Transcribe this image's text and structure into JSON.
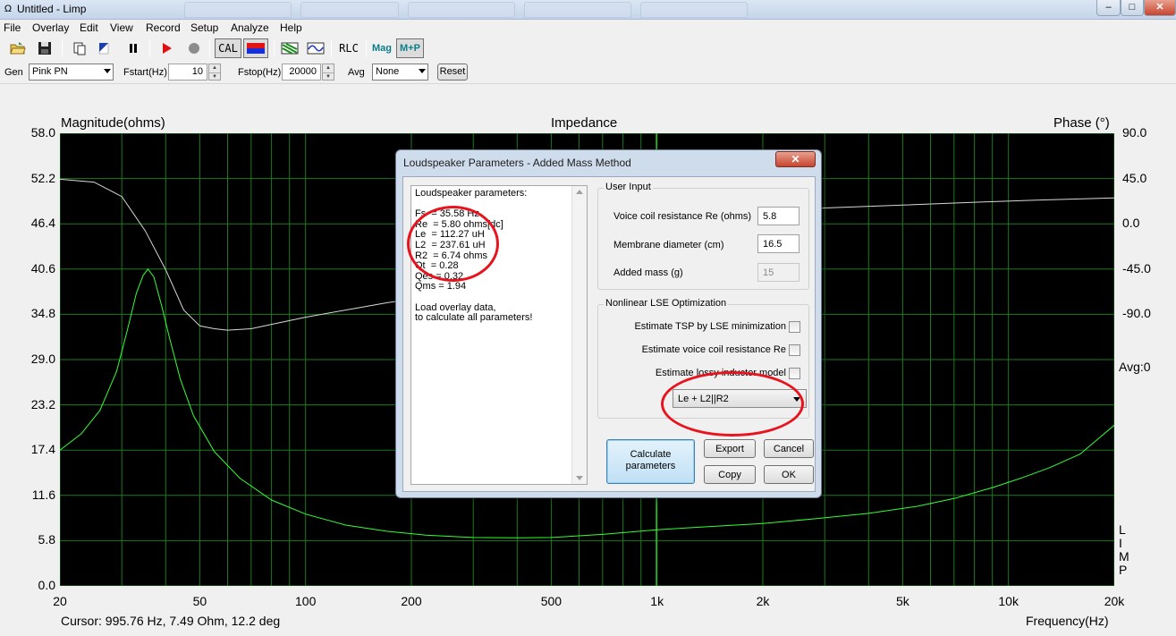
{
  "window": {
    "title": "Untitled - Limp",
    "app_icon": "Ω",
    "minimize": "–",
    "maximize": "□",
    "close": "✕"
  },
  "menu": [
    "File",
    "Overlay",
    "Edit",
    "View",
    "Record",
    "Setup",
    "Analyze",
    "Help"
  ],
  "toolbar": {
    "cal_label": "CAL",
    "rlc_label": "RLC",
    "mag_label": "Mag",
    "mp_label": "M+P"
  },
  "genbar": {
    "gen_label": "Gen",
    "gen_value": "Pink PN",
    "fstart_label": "Fstart(Hz)",
    "fstart_value": "10",
    "fstop_label": "Fstop(Hz)",
    "fstop_value": "20000",
    "avg_label": "Avg",
    "avg_value": "None",
    "reset_label": "Reset"
  },
  "plot": {
    "left_title": "Magnitude(ohms)",
    "center_title": "Impedance",
    "right_title": "Phase (°)",
    "avg_label": "Avg:0",
    "limp_letters": [
      "L",
      "I",
      "M",
      "P"
    ],
    "cursor_readout": "Cursor: 995.76 Hz, 7.49 Ohm, 12.2 deg",
    "x_label": "Frequency(Hz)"
  },
  "chart_data": {
    "type": "line",
    "title": "Impedance",
    "xlabel": "Frequency(Hz)",
    "ylabel": "Magnitude(ohms)",
    "y2label": "Phase (°)",
    "xscale": "log",
    "xlim": [
      20,
      20000
    ],
    "ylim": [
      0,
      58
    ],
    "y2lim": [
      -225,
      90
    ],
    "grid": true,
    "x_tick_labels": [
      "20",
      "50",
      "100",
      "200",
      "500",
      "1k",
      "2k",
      "5k",
      "10k",
      "20k"
    ],
    "x_tick_values": [
      20,
      50,
      100,
      200,
      500,
      1000,
      2000,
      5000,
      10000,
      20000
    ],
    "y_tick_labels": [
      "58.0",
      "52.2",
      "46.4",
      "40.6",
      "34.8",
      "29.0",
      "23.2",
      "17.4",
      "11.6",
      "5.8",
      "0.0"
    ],
    "y2_tick_labels": [
      "90.0",
      "45.0",
      "0.0",
      "-45.0",
      "-90.0"
    ],
    "cursor_hz": 995.76,
    "series": [
      {
        "name": "Magnitude",
        "axis": "left",
        "color": "#33ff33",
        "x": [
          20,
          23,
          26,
          29,
          31,
          33,
          34.5,
          35.6,
          37,
          39,
          41,
          44,
          48,
          55,
          65,
          80,
          100,
          130,
          170,
          220,
          300,
          400,
          500,
          700,
          1000,
          1400,
          2000,
          2800,
          4000,
          5500,
          7000,
          9000,
          11000,
          13000,
          16000,
          20000
        ],
        "y": [
          17.4,
          19.5,
          22.5,
          27.5,
          32.5,
          37.5,
          39.8,
          40.6,
          39.6,
          35.8,
          31.8,
          26.5,
          21.8,
          17.2,
          13.8,
          11.0,
          9.2,
          7.8,
          7.0,
          6.5,
          6.2,
          6.15,
          6.2,
          6.6,
          7.2,
          7.6,
          8.0,
          8.6,
          9.3,
          10.2,
          11.2,
          12.6,
          13.9,
          15.1,
          16.9,
          20.6
        ]
      },
      {
        "name": "Phase",
        "axis": "right",
        "color": "#d8d8d8",
        "x": [
          20,
          25,
          30,
          35,
          40,
          45,
          50,
          55,
          60,
          70,
          80,
          100,
          130,
          170,
          220,
          300,
          400,
          500
        ],
        "y": [
          58,
          56,
          46,
          22,
          -5,
          -33,
          -44,
          -46,
          -47,
          -46,
          -43,
          -38,
          -33,
          -28,
          -24,
          -20,
          -14,
          -10
        ]
      },
      {
        "name": "Phase (right segment)",
        "axis": "right",
        "color": "#d8d8d8",
        "x": [
          2000,
          3000,
          5000,
          8000,
          12000,
          20000
        ],
        "y": [
          35,
          38,
          40,
          42,
          43.5,
          45
        ]
      }
    ]
  },
  "dialog": {
    "title": "Loudspeaker Parameters - Added Mass Method",
    "close": "✕",
    "results_text": "Loudspeaker parameters:\n\nFs  = 35.58 Hz\nRe  = 5.80 ohms[dc]\nLe  = 112.27 uH\nL2  = 237.61 uH\nR2  = 6.74 ohms\nQt  = 0.28\nQes = 0.32\nQms = 1.94\n\nLoad overlay data,\nto calculate all parameters!",
    "user_input": {
      "title": "User Input",
      "re_label": "Voice coil resistance Re (ohms)",
      "re_value": "5.8",
      "diam_label": "Membrane diameter (cm)",
      "diam_value": "16.5",
      "mass_label": "Added mass (g)",
      "mass_value": "15"
    },
    "lse": {
      "title": "Nonlinear LSE Optimization",
      "opt1": "Estimate TSP by LSE minimization",
      "opt2": "Estimate voice coil resistance Re",
      "opt3": "Estimate lossy inductor model",
      "model_value": "Le + L2||R2"
    },
    "buttons": {
      "calculate": "Calculate parameters",
      "export": "Export",
      "cancel": "Cancel",
      "copy": "Copy",
      "ok": "OK"
    }
  },
  "annotation_color": "#e8131d"
}
